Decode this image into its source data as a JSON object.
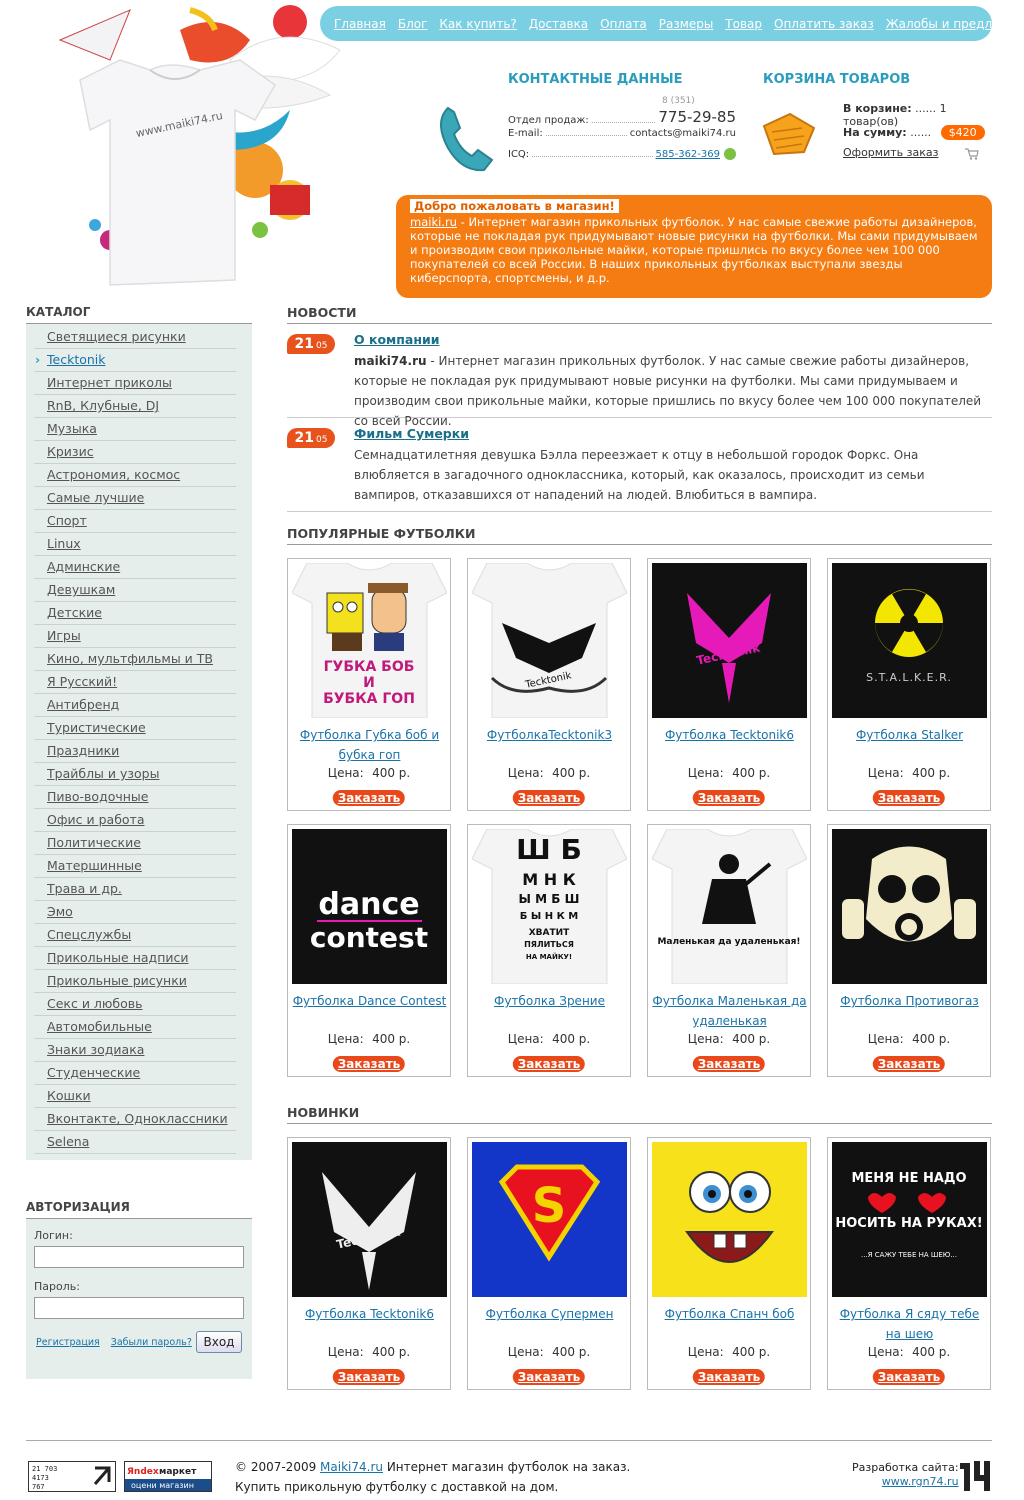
{
  "nav": [
    "Главная",
    "Блог",
    "Как купить?",
    "Доставка",
    "Оплата",
    "Размеры",
    "Товар",
    "Оплатить заказ",
    "Жалобы и предложения"
  ],
  "contacts": {
    "title": "КОНТАКТНЫЕ ДАННЫЕ",
    "sales_label": "Отдел продаж:",
    "phone_code": "8 (351)",
    "phone": "775-29-85",
    "email_label": "E-mail:",
    "email": "contacts@maiki74.ru",
    "icq_label": "ICQ:",
    "icq": "585-362-369"
  },
  "cart": {
    "title": "КОРЗИНА ТОВАРОВ",
    "count_label": "В корзине:",
    "count_value": "1 товар(ов)",
    "sum_label": "На сумму:",
    "sum_value": "$420",
    "checkout": "Оформить заказ"
  },
  "welcome": {
    "title": "Добро пожаловать в магазин!",
    "site_link": "maiki.ru",
    "text": " - Интернет магазин прикольных футболок. У нас самые свежие работы дизайнеров, которые не покладая рук придумывают новые рисунки на футболки. Мы сами придумываем и производим свои прикольные майки, которые пришлись по вкусу более чем 100 000 покупателей со всей России. В наших прикольных футболках выступали звезды киберспорта, спортсмены, и д.р."
  },
  "sidebar": {
    "catalog_title": "КАТАЛОГ",
    "categories": [
      "Светящиеся рисунки",
      "Tecktonik",
      "Интернет приколы",
      "RnB, Клубные, DJ",
      "Музыка",
      "Кризис",
      "Астрономия, космос",
      "Самые лучшие",
      "Спорт",
      "Linux",
      "Админские",
      "Девушкам",
      "Детские",
      "Игры",
      "Кино, мультфильмы и ТВ",
      "Я Русский!",
      "Антибренд",
      "Туристические",
      "Праздники",
      "Трайблы и узоры",
      "Пиво-водочные",
      "Офис и работа",
      "Политические",
      "Матершинные",
      "Трава и др.",
      "Эмо",
      "Спецслужбы",
      "Прикольные надписи",
      "Прикольные рисунки",
      "Секс и любовь",
      "Автомобильные",
      "Знаки зодиака",
      "Студенческие",
      "Кошки",
      "Вконтакте, Одноклассники",
      "Selena"
    ],
    "active_category": "Tecktonik",
    "auth_title": "АВТОРИЗАЦИЯ",
    "login_label": "Логин:",
    "password_label": "Пароль:",
    "register": "Регистрация",
    "forgot": "Забыли пароль?",
    "submit": "Вход"
  },
  "news": {
    "title": "НОВОСТИ",
    "items": [
      {
        "day": "21",
        "month": "05",
        "title": "О компании",
        "lead": "maiki74.ru",
        "text": " - Интернет магазин прикольных футболок. У нас самые свежие работы дизайнеров, которые не покладая рук придумывают новые рисунки на футболки. Мы сами придумываем и производим свои прикольные майки, которые пришлись по вкусу более чем 100 000 покупателей со всей России."
      },
      {
        "day": "21",
        "month": "05",
        "title": "Фильм Сумерки",
        "lead": "",
        "text": "Семнадцатилетняя девушка Бэлла переезжает к отцу в небольшой городок Форкс. Она влюбляется в загадочного одноклассника, который, как оказалось, происходит из семьи вампиров, отказавшихся от нападений на людей. Влюбиться в вампира."
      }
    ]
  },
  "popular": {
    "title": "ПОПУЛЯРНЫЕ ФУТБОЛКИ",
    "items": [
      {
        "name": "Футболка Губка боб и бубка гоп",
        "price": "400 р.",
        "shirt": "white",
        "art": "spongebob-gop"
      },
      {
        "name": "ФутболкаTecktonik3",
        "price": "400 р.",
        "shirt": "white",
        "art": "tecktonik-eagle"
      },
      {
        "name": "Футболка Tecktonik6",
        "price": "400 р.",
        "shirt": "black",
        "art": "tecktonik-pink"
      },
      {
        "name": "Футболка Stalker",
        "price": "400 р.",
        "shirt": "black",
        "art": "radiation-stalker"
      },
      {
        "name": "Футболка Dance Contest",
        "price": "400 р.",
        "shirt": "black",
        "art": "dance-contest"
      },
      {
        "name": "Футболка Зрение",
        "price": "400 р.",
        "shirt": "white",
        "art": "eye-chart"
      },
      {
        "name": "Футболка Маленькая да удаленькая",
        "price": "400 р.",
        "shirt": "white",
        "art": "little-girl"
      },
      {
        "name": "Футболка Противогаз",
        "price": "400 р.",
        "shirt": "black",
        "art": "gas-mask"
      }
    ]
  },
  "new_items": {
    "title": "НОВИНКИ",
    "items": [
      {
        "name": "Футболка Tecktonik6",
        "price": "400 р.",
        "shirt": "black",
        "art": "tecktonik-white"
      },
      {
        "name": "Футболка Супермен",
        "price": "400 р.",
        "shirt": "blue",
        "art": "superman"
      },
      {
        "name": "Футболка Спанч боб",
        "price": "400 р.",
        "shirt": "yellow",
        "art": "spongebob-face"
      },
      {
        "name": "Футболка Я сяду тебе на шею",
        "price": "400 р.",
        "shirt": "black",
        "art": "hearts-text"
      }
    ]
  },
  "price_label": "Цена:",
  "order_label": "Заказать",
  "art_text": {
    "gop_line1": "ГУБКА БОБ",
    "gop_line2": "И",
    "gop_line3": "БУБКА ГОП",
    "tecktonik": "Tecktonik",
    "stalker": "S.T.A.L.K.E.R.",
    "dance": "dance",
    "contest": "contest",
    "eye_rows": [
      "Ш Б",
      "М Н К",
      "Ы М Б Ш",
      "Б Ы Н К М",
      "ХВАТИТ",
      "ПЯЛИТЬСЯ",
      "НА МАЙКУ!"
    ],
    "little_girl": "Маленькая да удаленькая!",
    "hearts_1": "МЕНЯ НЕ НАДО",
    "hearts_2": "НОСИТЬ НА РУКАХ!",
    "hearts_3": "...Я САЖУ ТЕБЕ НА ШЕЮ..."
  },
  "hero": {
    "shirt_text": "www.maiki74.ru"
  },
  "footer": {
    "copy_prefix": "© 2007-2009 ",
    "site": "Maiki74.ru",
    "copy_suffix": " Интернет магазин футболок на заказ.",
    "line2": "Купить прикольную футболку с доставкой на дом.",
    "dev_label": "Разработка сайта:",
    "dev_link": "www.rgn74.ru",
    "counter1": "21 703 / 4173 / 767",
    "counter2_brand": "Яndex маркет",
    "counter2_sub": "оцени магазин"
  },
  "colors": {
    "accent_blue": "#7ad0e2",
    "orange": "#f57c12",
    "order_red": "#e9481a",
    "sidebar_bg": "#e6eeec"
  }
}
